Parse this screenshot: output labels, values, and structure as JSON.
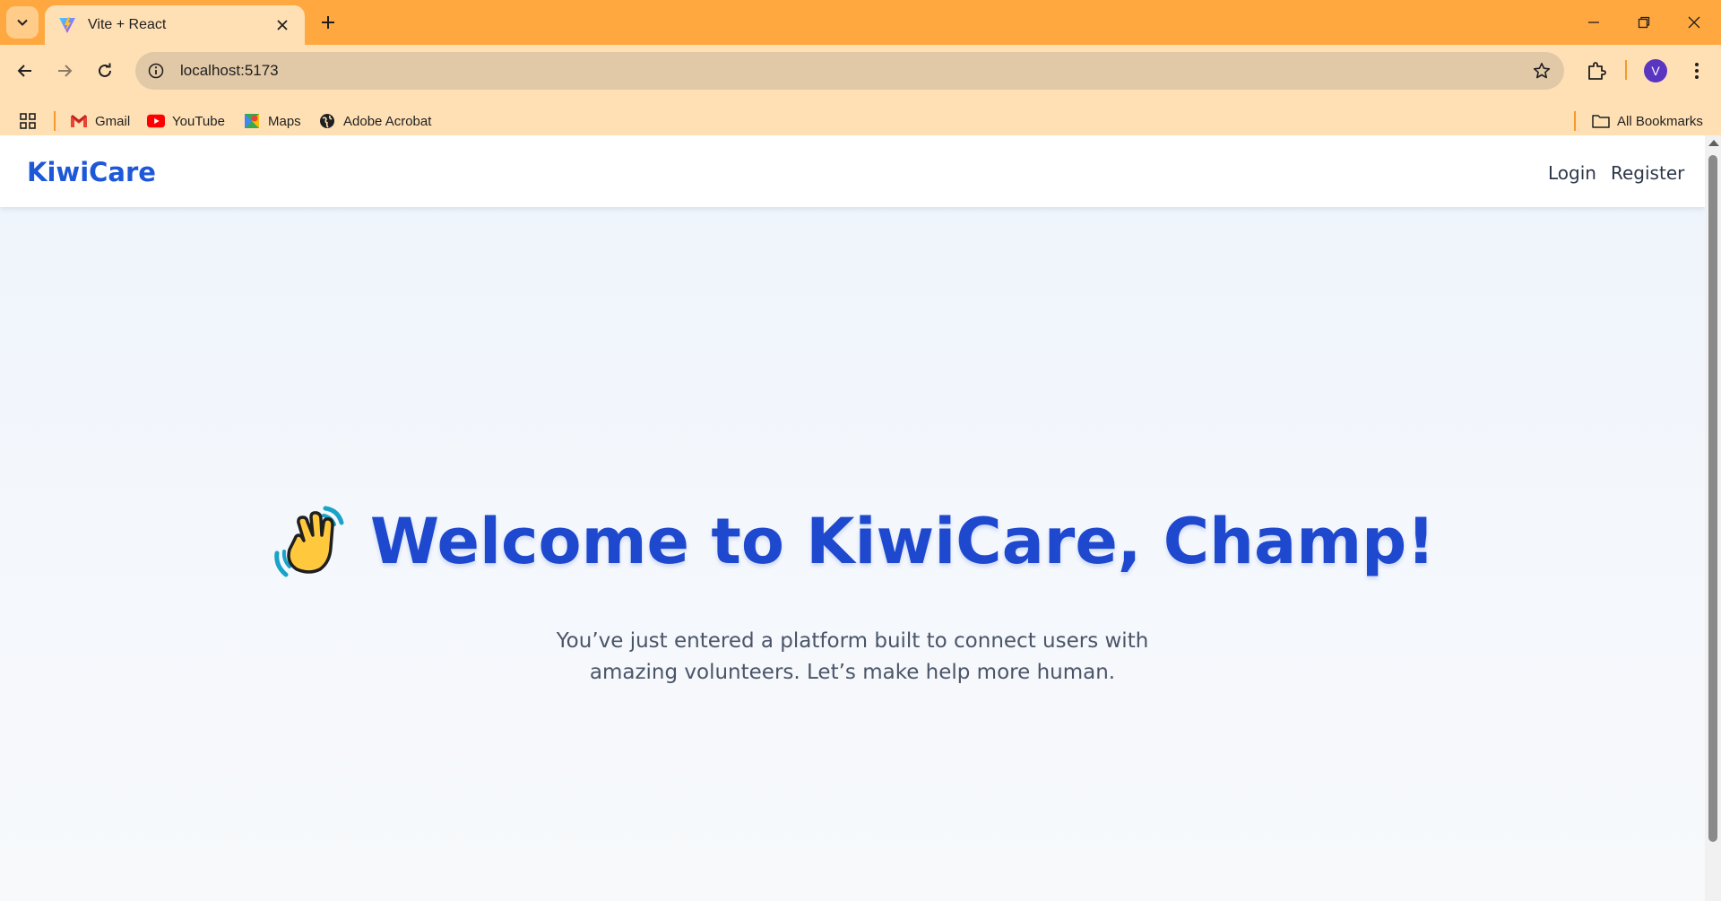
{
  "browser": {
    "tab": {
      "title": "Vite + React",
      "favicon": "vite-logo-icon"
    },
    "address": {
      "url": "localhost:5173"
    },
    "profile_initial": "V",
    "bookmarks": [
      {
        "label": "Gmail",
        "icon": "gmail-icon"
      },
      {
        "label": "YouTube",
        "icon": "youtube-icon"
      },
      {
        "label": "Maps",
        "icon": "maps-icon"
      },
      {
        "label": "Adobe Acrobat",
        "icon": "globe-icon"
      }
    ],
    "all_bookmarks_label": "All Bookmarks",
    "colors": {
      "tabbar": "#ffa83f",
      "toolbar": "#ffe0b5",
      "omnibox": "#e1c8a6"
    }
  },
  "app": {
    "brand": "KiwiCare",
    "nav": {
      "login": "Login",
      "register": "Register"
    },
    "hero": {
      "title": "Welcome to KiwiCare, Champ!",
      "emoji_icon": "waving-hand-icon",
      "subtitle_line1": "You’ve just entered a platform built to connect users with",
      "subtitle_line2": "amazing volunteers. Let’s make help more human."
    },
    "colors": {
      "brand": "#1d58d8",
      "title": "#1e49cf",
      "text": "#4a5568"
    }
  }
}
